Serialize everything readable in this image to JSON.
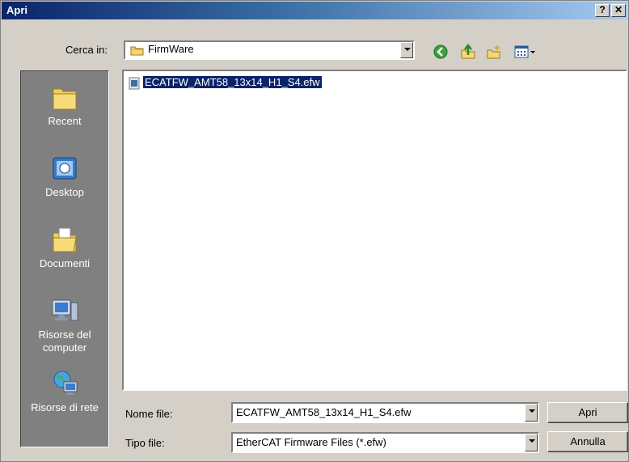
{
  "window": {
    "title": "Apri",
    "help_label": "?",
    "close_label": "✕"
  },
  "lookin": {
    "label": "Cerca in:",
    "value": "FirmWare"
  },
  "toolbar": {
    "icons": [
      "back-icon",
      "up-folder-icon",
      "new-folder-icon",
      "view-menu-icon"
    ]
  },
  "places": {
    "items": [
      {
        "label": "Recent",
        "icon": "recent-folder-icon"
      },
      {
        "label": "Desktop",
        "icon": "desktop-icon"
      },
      {
        "label": "Documenti",
        "icon": "documents-icon"
      },
      {
        "label": "Risorse del computer",
        "icon": "my-computer-icon"
      },
      {
        "label": "Risorse di rete",
        "icon": "network-icon"
      }
    ]
  },
  "files": [
    {
      "name": "ECATFW_AMT58_13x14_H1_S4.efw",
      "selected": true
    }
  ],
  "filename": {
    "label": "Nome file:",
    "value": "ECATFW_AMT58_13x14_H1_S4.efw"
  },
  "filetype": {
    "label": "Tipo file:",
    "value": "EtherCAT Firmware Files (*.efw)"
  },
  "buttons": {
    "open": "Apri",
    "cancel": "Annulla"
  }
}
